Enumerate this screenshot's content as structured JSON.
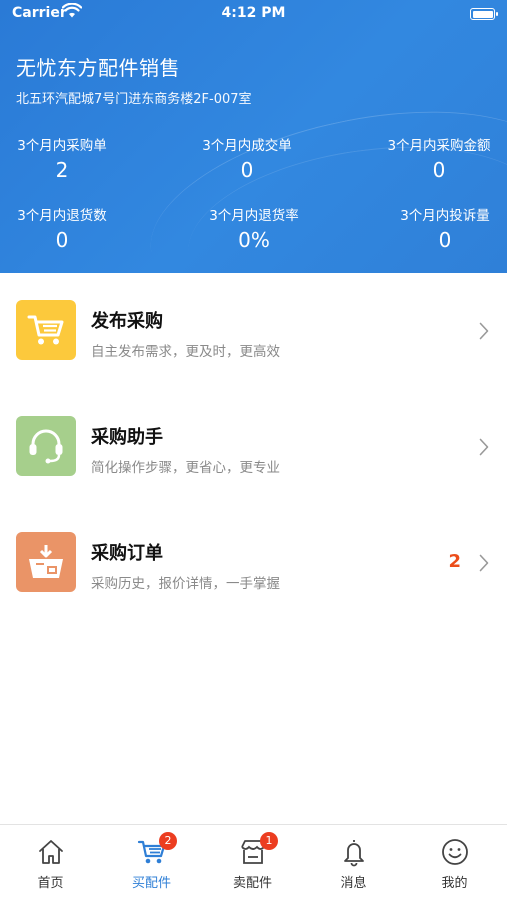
{
  "status_bar": {
    "carrier": "Carrier",
    "time": "4:12 PM"
  },
  "shop": {
    "name": "无忧东方配件销售",
    "address": "北五环汽配城7号门进东商务楼2F-007室"
  },
  "stats": [
    {
      "label": "3个月内采购单",
      "value": "2"
    },
    {
      "label": "3个月内成交单",
      "value": "0"
    },
    {
      "label": "3个月内采购金额",
      "value": "0"
    },
    {
      "label": "3个月内退货数",
      "value": "0"
    },
    {
      "label": "3个月内退货率",
      "value": "0%"
    },
    {
      "label": "3个月内投诉量",
      "value": "0"
    }
  ],
  "menu": [
    {
      "title": "发布采购",
      "desc": "自主发布需求，更及时，更高效",
      "icon": "cart-icon",
      "color": "#fcc93c"
    },
    {
      "title": "采购助手",
      "desc": "简化操作步骤，更省心，更专业",
      "icon": "headset-icon",
      "color": "#a6cf8c"
    },
    {
      "title": "采购订单",
      "desc": "采购历史，报价详情，一手掌握",
      "icon": "basket-icon",
      "color": "#ea9467",
      "count": "2"
    }
  ],
  "tabs": [
    {
      "label": "首页",
      "icon": "home-icon"
    },
    {
      "label": "买配件",
      "icon": "cart-icon",
      "badge": "2",
      "active": true
    },
    {
      "label": "卖配件",
      "icon": "shop-icon",
      "badge": "1"
    },
    {
      "label": "消息",
      "icon": "bell-icon"
    },
    {
      "label": "我的",
      "icon": "smile-icon"
    }
  ],
  "colors": {
    "header_blue": "#2f80d8",
    "active_tab": "#2f7fd6",
    "badge_red": "#ec3d20",
    "count_orange": "#ec4d1a"
  }
}
